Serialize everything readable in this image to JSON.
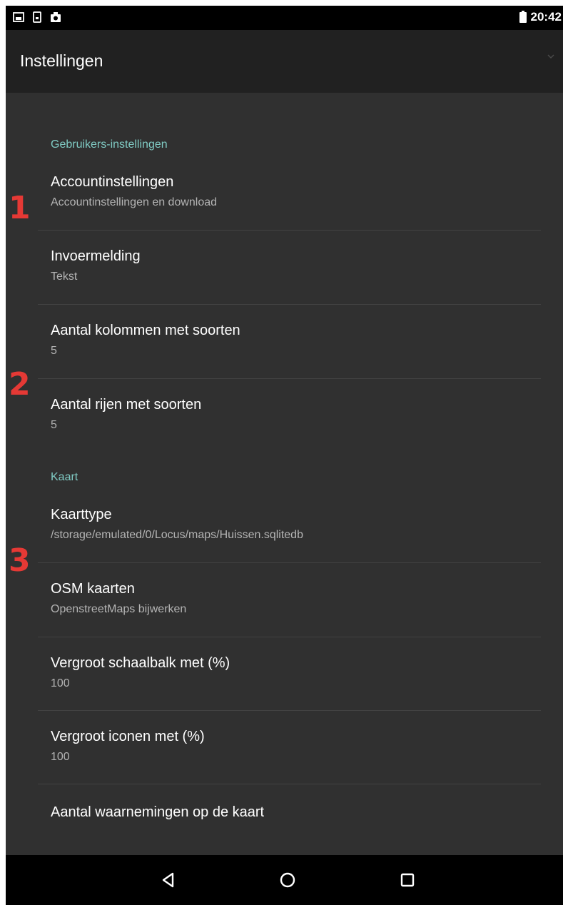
{
  "status_bar": {
    "time": "20:42",
    "icons": [
      "gallery-icon",
      "sim-icon",
      "photo-icon",
      "battery-icon"
    ]
  },
  "app_bar": {
    "title": "Instellingen"
  },
  "sections": [
    {
      "header": "Gebruikers-instellingen",
      "items": [
        {
          "title": "Accountinstellingen",
          "summary": "Accountinstellingen en download"
        },
        {
          "title": "Invoermelding",
          "summary": "Tekst"
        },
        {
          "title": "Aantal kolommen met soorten",
          "summary": "5"
        },
        {
          "title": "Aantal rijen met soorten",
          "summary": "5"
        }
      ]
    },
    {
      "header": "Kaart",
      "items": [
        {
          "title": "Kaarttype",
          "summary": "/storage/emulated/0/Locus/maps/Huissen.sqlitedb"
        },
        {
          "title": "OSM kaarten",
          "summary": "OpenstreetMaps bijwerken"
        },
        {
          "title": "Vergroot schaalbalk met (%)",
          "summary": "100"
        },
        {
          "title": "Vergroot iconen met (%)",
          "summary": "100"
        },
        {
          "title": "Aantal waarnemingen op de kaart",
          "summary": ""
        }
      ]
    }
  ],
  "annotations": [
    "1",
    "2",
    "3"
  ],
  "colors": {
    "background": "#303030",
    "app_bar": "#212121",
    "accent": "#80cbc4",
    "annotation": "#e53935"
  },
  "nav_bar": {
    "buttons": [
      "back-icon",
      "home-icon",
      "recents-icon"
    ]
  }
}
